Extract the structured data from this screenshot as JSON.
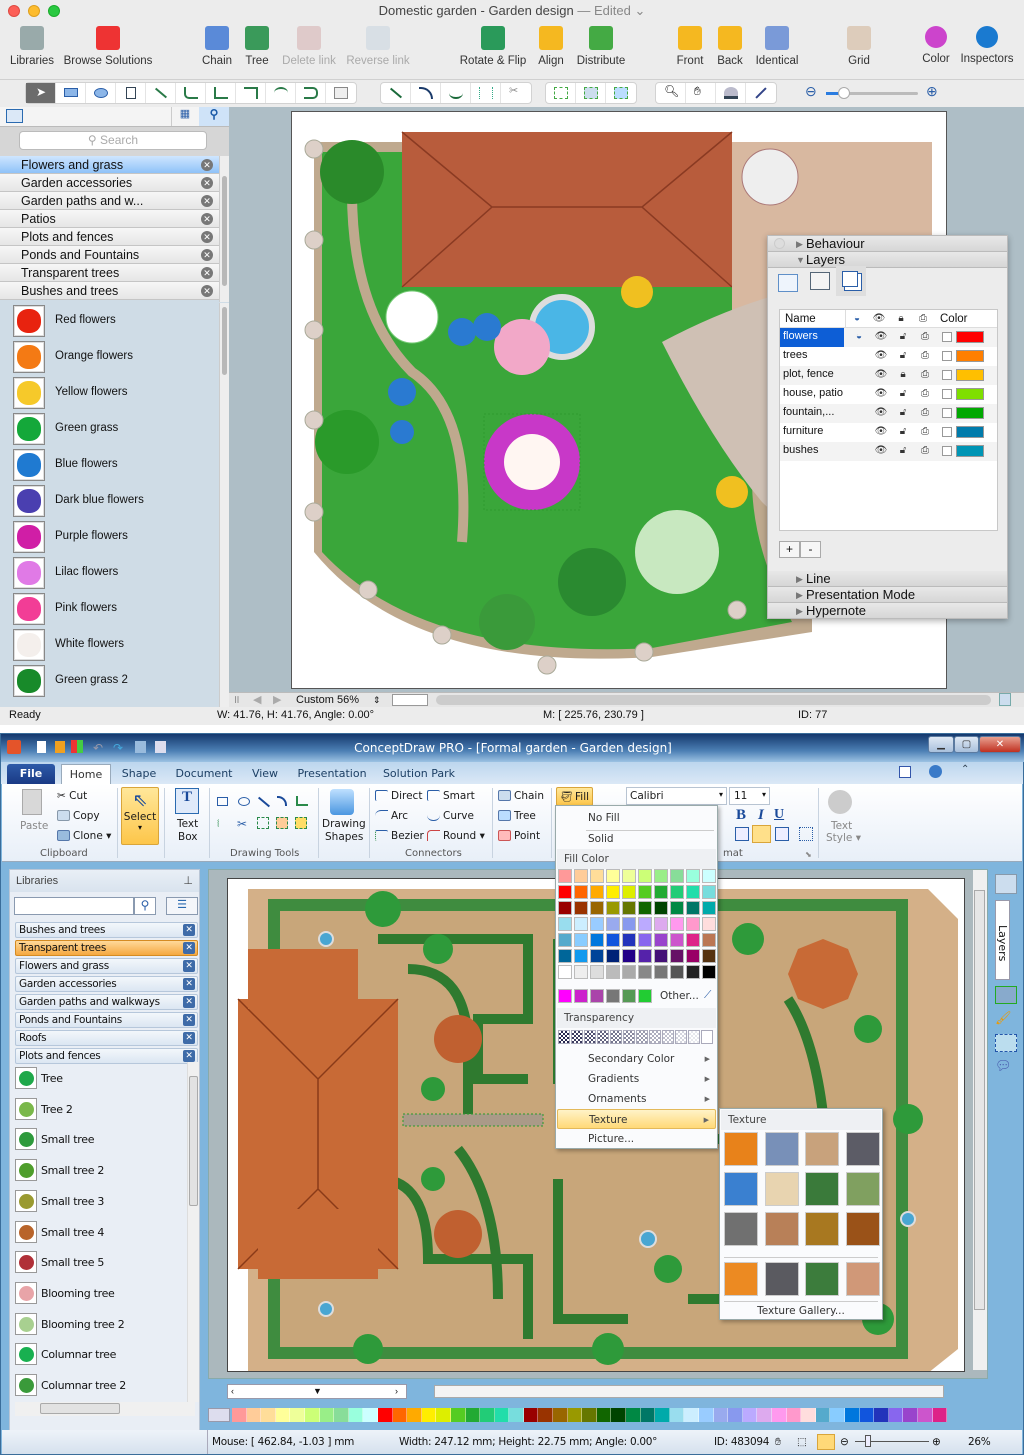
{
  "mac": {
    "title": "Domestic garden - Garden design",
    "title_status": "— Edited",
    "toolbar": [
      {
        "id": "libraries",
        "label": "Libraries",
        "icon": "libraries-icon",
        "enabled": true
      },
      {
        "id": "browse",
        "label": "Browse Solutions",
        "icon": "browse-solutions-icon",
        "enabled": true
      },
      {
        "id": "chain",
        "label": "Chain",
        "icon": "chain-icon",
        "enabled": true
      },
      {
        "id": "tree",
        "label": "Tree",
        "icon": "tree-icon",
        "enabled": true
      },
      {
        "id": "delete-link",
        "label": "Delete link",
        "icon": "delete-link-icon",
        "enabled": false
      },
      {
        "id": "reverse-link",
        "label": "Reverse link",
        "icon": "reverse-link-icon",
        "enabled": false
      },
      {
        "id": "rotate",
        "label": "Rotate & Flip",
        "icon": "rotate-flip-icon",
        "enabled": true
      },
      {
        "id": "align",
        "label": "Align",
        "icon": "align-icon",
        "enabled": true
      },
      {
        "id": "distribute",
        "label": "Distribute",
        "icon": "distribute-icon",
        "enabled": true
      },
      {
        "id": "front",
        "label": "Front",
        "icon": "bring-front-icon",
        "enabled": true
      },
      {
        "id": "back",
        "label": "Back",
        "icon": "send-back-icon",
        "enabled": true
      },
      {
        "id": "identical",
        "label": "Identical",
        "icon": "identical-icon",
        "enabled": true
      },
      {
        "id": "grid",
        "label": "Grid",
        "icon": "grid-icon",
        "enabled": true
      },
      {
        "id": "color",
        "label": "Color",
        "icon": "color-wheel-icon",
        "enabled": true
      },
      {
        "id": "inspectors",
        "label": "Inspectors",
        "icon": "info-icon",
        "enabled": true
      }
    ],
    "search_placeholder": "Search",
    "libraries": [
      {
        "label": "Flowers and grass",
        "selected": true
      },
      {
        "label": "Garden accessories"
      },
      {
        "label": "Garden paths and w..."
      },
      {
        "label": "Patios"
      },
      {
        "label": "Plots and fences"
      },
      {
        "label": "Ponds and Fountains"
      },
      {
        "label": "Transparent trees"
      },
      {
        "label": "Bushes and trees"
      }
    ],
    "shapes": [
      {
        "label": "Red flowers",
        "color": "#e8230f"
      },
      {
        "label": "Orange flowers",
        "color": "#f47a14"
      },
      {
        "label": "Yellow flowers",
        "color": "#f6c92a"
      },
      {
        "label": "Green grass",
        "color": "#14a83a"
      },
      {
        "label": "Blue flowers",
        "color": "#1f7ad1"
      },
      {
        "label": "Dark blue flowers",
        "color": "#4a3fb0"
      },
      {
        "label": "Purple flowers",
        "color": "#d01ea6"
      },
      {
        "label": "Lilac flowers",
        "color": "#e07ae6"
      },
      {
        "label": "Pink flowers",
        "color": "#f23d96"
      },
      {
        "label": "White flowers",
        "color": "#f4efec"
      },
      {
        "label": "Green grass 2",
        "color": "#188a2a"
      }
    ],
    "inspector": {
      "sections_top": [
        "Behaviour",
        "Layers"
      ],
      "sections_bottom": [
        "Line",
        "Presentation Mode",
        "Hypernote"
      ],
      "columns": [
        "Name",
        "Color"
      ],
      "layers": [
        {
          "name": "flowers",
          "color": "#ff0000",
          "selected": true,
          "current": true
        },
        {
          "name": "trees",
          "color": "#ff7f00"
        },
        {
          "name": "plot, fence",
          "color": "#ffbf00",
          "locked": true
        },
        {
          "name": "house, patio",
          "color": "#7fdf00"
        },
        {
          "name": "fountain,...",
          "color": "#00a800"
        },
        {
          "name": "furniture",
          "color": "#007bab"
        },
        {
          "name": "bushes",
          "color": "#0095b5"
        }
      ],
      "add_label": "+",
      "remove_label": "-"
    },
    "zoom_level": "Custom 56%",
    "status": {
      "ready": "Ready",
      "size": "W: 41.76,  H: 41.76,  Angle: 0.00°",
      "mouse": "M: [ 225.76, 230.79 ]",
      "id": "ID: 77"
    }
  },
  "win": {
    "title": "ConceptDraw PRO - [Formal garden - Garden design]",
    "tabs": [
      "File",
      "Home",
      "Shape",
      "Document",
      "View",
      "Presentation",
      "Solution Park"
    ],
    "active_tab": "Home",
    "ribbon": {
      "clipboard": {
        "paste": "Paste",
        "cut": "Cut",
        "copy": "Copy",
        "clone": "Clone",
        "group": "Clipboard"
      },
      "select": "Select",
      "textbox": [
        "Text",
        "Box"
      ],
      "drawing_tools": "Drawing Tools",
      "drawing_shapes": [
        "Drawing",
        "Shapes"
      ],
      "connectors": {
        "direct": "Direct",
        "smart": "Smart",
        "arc": "Arc",
        "curve": "Curve",
        "bezier": "Bezier",
        "round": "Round",
        "group": "Connectors"
      },
      "chain": "Chain",
      "tree": "Tree",
      "point": "Point",
      "fill": "Fill",
      "font": "Calibri",
      "font_size": "11",
      "format_group": "mat",
      "text_style": [
        "Text",
        "Style"
      ]
    },
    "libraries_title": "Libraries",
    "libraries": [
      {
        "label": "Bushes and trees"
      },
      {
        "label": "Transparent trees",
        "selected": true
      },
      {
        "label": "Flowers and grass"
      },
      {
        "label": "Garden accessories"
      },
      {
        "label": "Garden paths and walkways"
      },
      {
        "label": "Ponds and Fountains"
      },
      {
        "label": "Roofs"
      },
      {
        "label": "Plots and fences"
      }
    ],
    "shapes": [
      {
        "label": "Tree",
        "color": "#1fa84a"
      },
      {
        "label": "Tree 2",
        "color": "#7ab84a"
      },
      {
        "label": "Small tree",
        "color": "#2e9a3c"
      },
      {
        "label": "Small tree 2",
        "color": "#4f9e2c"
      },
      {
        "label": "Small tree 3",
        "color": "#9a9a30"
      },
      {
        "label": "Small tree 4",
        "color": "#b8642a"
      },
      {
        "label": "Small tree 5",
        "color": "#b03038"
      },
      {
        "label": "Blooming tree",
        "color": "#e8a4a8"
      },
      {
        "label": "Blooming tree 2",
        "color": "#a8d090"
      },
      {
        "label": "Columnar tree",
        "color": "#18b050"
      },
      {
        "label": "Columnar tree 2",
        "color": "#3a9a3a"
      }
    ],
    "fill_menu": {
      "no_fill": "No Fill",
      "solid": "Solid",
      "fill_color": "Fill Color",
      "swatches": [
        "#ff9999",
        "#ffcc99",
        "#ffdd99",
        "#ffff99",
        "#eeff99",
        "#ccff77",
        "#99ee88",
        "#88dd99",
        "#99ffdd",
        "#ccffff",
        "#ff0000",
        "#ff6600",
        "#ffaa00",
        "#ffee00",
        "#ddee00",
        "#55cc22",
        "#22aa33",
        "#22cc77",
        "#22ddaa",
        "#77dddd",
        "#990000",
        "#993300",
        "#996600",
        "#999900",
        "#667700",
        "#116600",
        "#004400",
        "#008844",
        "#007766",
        "#00aaaa",
        "#99ddee",
        "#cceeff",
        "#99ccff",
        "#99aaee",
        "#8899ee",
        "#bbaaff",
        "#ddaaee",
        "#ff99ee",
        "#ff99cc",
        "#ffdddd",
        "#55aacc",
        "#88ccff",
        "#0077dd",
        "#1155dd",
        "#2233bb",
        "#8866ee",
        "#9944cc",
        "#cc55cc",
        "#dd2288",
        "#bb7755",
        "#006699",
        "#1199ee",
        "#004499",
        "#002277",
        "#220088",
        "#5522aa",
        "#441177",
        "#661166",
        "#990066",
        "#553311",
        "#ffffff",
        "#eeeeee",
        "#dddddd",
        "#bbbbbb",
        "#aaaaaa",
        "#888888",
        "#777777",
        "#555555",
        "#222222",
        "#000000"
      ],
      "recent": [
        "#ff00ff",
        "#cc22cc",
        "#aa44aa",
        "#777777",
        "#559955",
        "#22cc33"
      ],
      "other": "Other...",
      "transparency": "Transparency",
      "items": [
        {
          "label": "Secondary Color",
          "submenu": true
        },
        {
          "label": "Gradients",
          "submenu": true
        },
        {
          "label": "Ornaments",
          "submenu": true
        },
        {
          "label": "Texture",
          "submenu": true,
          "highlighted": true
        },
        {
          "label": "Picture..."
        }
      ]
    },
    "texture_menu": {
      "title": "Texture",
      "textures": [
        {
          "name": "orange-marble",
          "color": "#e8821a"
        },
        {
          "name": "denim",
          "color": "#7890b8"
        },
        {
          "name": "sand",
          "color": "#c8a27c"
        },
        {
          "name": "granite",
          "color": "#5c5c66"
        },
        {
          "name": "blue-water",
          "color": "#3a80d0"
        },
        {
          "name": "cream-paper",
          "color": "#e8d4b0"
        },
        {
          "name": "grass",
          "color": "#3a7a3a"
        },
        {
          "name": "moss",
          "color": "#80a060"
        },
        {
          "name": "diamond-plate",
          "color": "#707070"
        },
        {
          "name": "terracotta",
          "color": "#b88058"
        },
        {
          "name": "gold-wave",
          "color": "#a87820"
        },
        {
          "name": "wood",
          "color": "#9a5218"
        }
      ],
      "recent": [
        {
          "name": "orange-marble",
          "color": "#ec8a22"
        },
        {
          "name": "granite",
          "color": "#5a5a60"
        },
        {
          "name": "grass",
          "color": "#3c7c3c"
        },
        {
          "name": "terracotta",
          "color": "#d09878"
        }
      ],
      "gallery": "Texture Gallery..."
    },
    "side_tab": "Layers",
    "palette": [
      "#ff9999",
      "#ffcc99",
      "#ffdd99",
      "#ffff99",
      "#eeff99",
      "#ccff77",
      "#99ee88",
      "#88dd99",
      "#99ffdd",
      "#ccffff",
      "#ff0000",
      "#ff6600",
      "#ffaa00",
      "#ffee00",
      "#ddee00",
      "#55cc22",
      "#22aa33",
      "#22cc77",
      "#22ddaa",
      "#77dddd",
      "#990000",
      "#993300",
      "#996600",
      "#999900",
      "#667700",
      "#116600",
      "#004400",
      "#008844",
      "#007766",
      "#00aaaa",
      "#99ddee",
      "#cceeff",
      "#99ccff",
      "#99aaee",
      "#8899ee",
      "#bbaaff",
      "#ddaaee",
      "#ff99ee",
      "#ff99cc",
      "#ffdddd",
      "#55aacc",
      "#88ccff",
      "#0077dd",
      "#1155dd",
      "#2233bb",
      "#8866ee",
      "#9944cc",
      "#cc55cc",
      "#dd2288"
    ],
    "status": {
      "mouse": "Mouse: [ 462.84, -1.03 ] mm",
      "size": "Width: 247.12 mm;  Height: 22.75 mm;  Angle: 0.00°",
      "id": "ID: 483094",
      "zoom": "26%"
    }
  }
}
